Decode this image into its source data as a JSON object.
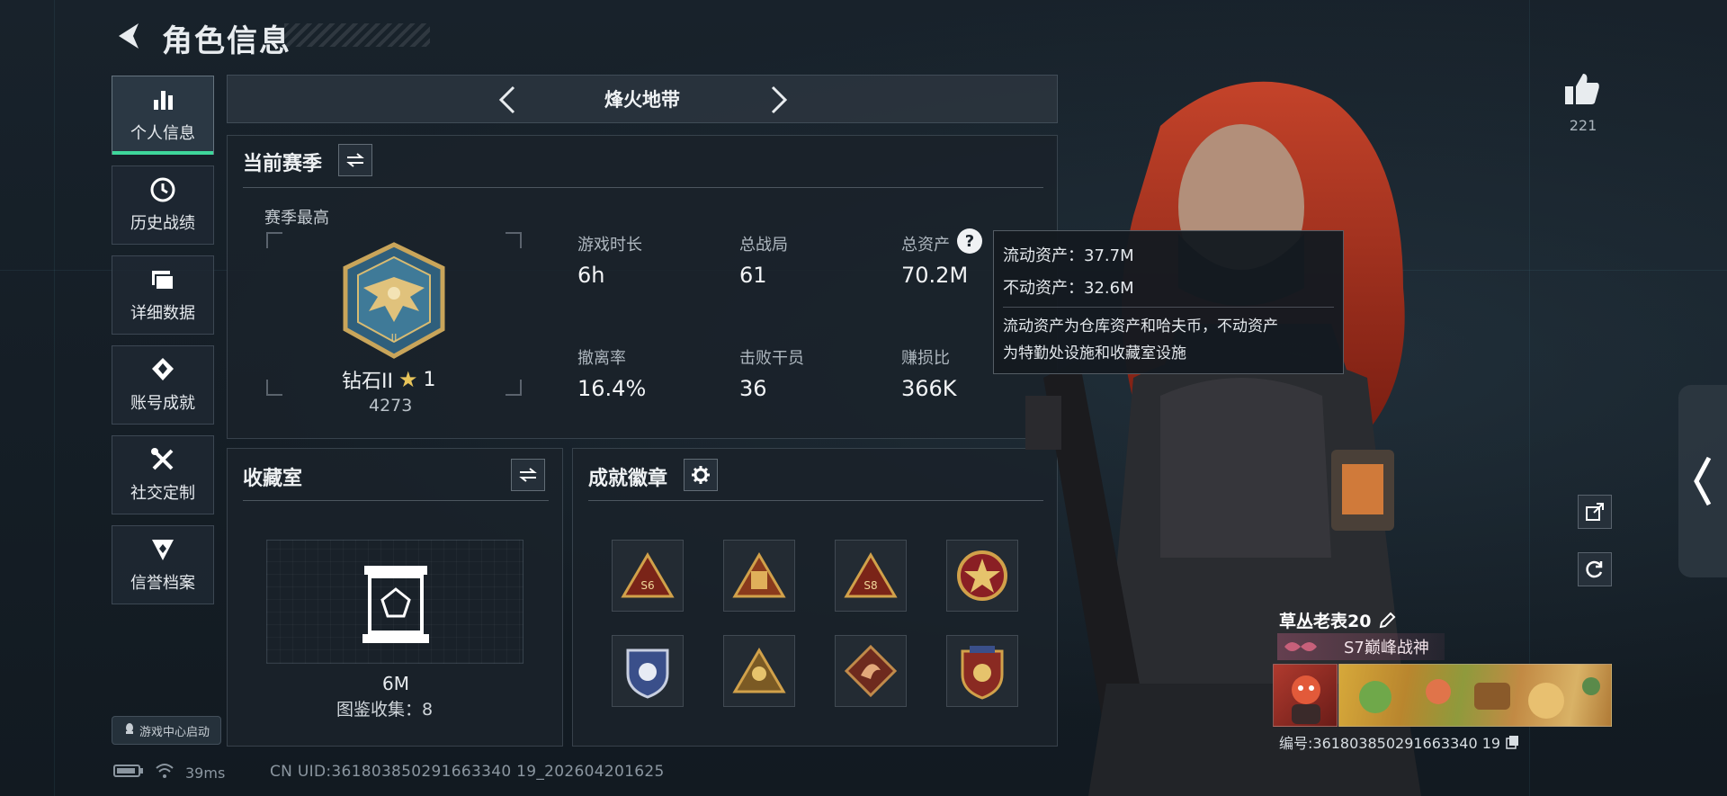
{
  "header": {
    "title": "角色信息"
  },
  "nav": {
    "items": [
      {
        "label": "个人信息",
        "icon": "bar-chart-icon",
        "active": true
      },
      {
        "label": "历史战绩",
        "icon": "history-clock-icon"
      },
      {
        "label": "详细数据",
        "icon": "folder-stack-icon"
      },
      {
        "label": "账号成就",
        "icon": "achievement-badge-icon"
      },
      {
        "label": "社交定制",
        "icon": "tools-icon"
      },
      {
        "label": "信誉档案",
        "icon": "credit-shield-icon"
      }
    ],
    "launch_label": "游戏中心启动"
  },
  "status": {
    "ping": "39ms",
    "uid": "CN UID:361803850291663340 19_202604201625"
  },
  "mode": {
    "title": "烽火地带"
  },
  "season": {
    "title": "当前赛季",
    "best_label": "赛季最高",
    "rank_name": "钻石II",
    "rank_stars": "1",
    "rank_score": "4273",
    "stats": [
      {
        "label": "游戏时长",
        "value": "6h"
      },
      {
        "label": "总战局",
        "value": "61"
      },
      {
        "label": "总资产",
        "value": "70.2M"
      },
      {
        "label": "撤离率",
        "value": "16.4%"
      },
      {
        "label": "击败干员",
        "value": "36"
      },
      {
        "label": "赚损比",
        "value": "366K"
      }
    ]
  },
  "tooltip": {
    "liquid": "流动资产：37.7M",
    "fixed": "不动资产：32.6M",
    "desc_line1": "流动资产为仓库资产和哈夫币，不动资产",
    "desc_line2": "为特勤处设施和收藏室设施"
  },
  "collection": {
    "title": "收藏室",
    "value": "6M",
    "collect_label": "图鉴收集：8"
  },
  "badges": {
    "title": "成就徽章",
    "items": [
      "s6-triangle-badge-icon",
      "ticket-triangle-badge-icon",
      "s8-triangle-badge-icon",
      "star-medal-badge-icon",
      "shield-crest-badge-icon",
      "soldier-triangle-badge-icon",
      "dragon-badge-icon",
      "eagle-shield-badge-icon"
    ]
  },
  "profile": {
    "likes": "221",
    "name": "草丛老表20",
    "title": "S7巅峰战神",
    "id": "编号:361803850291663340 19"
  },
  "colors": {
    "accent": "#3fd79b",
    "background": "#141c24",
    "panel": "#1a222a"
  }
}
